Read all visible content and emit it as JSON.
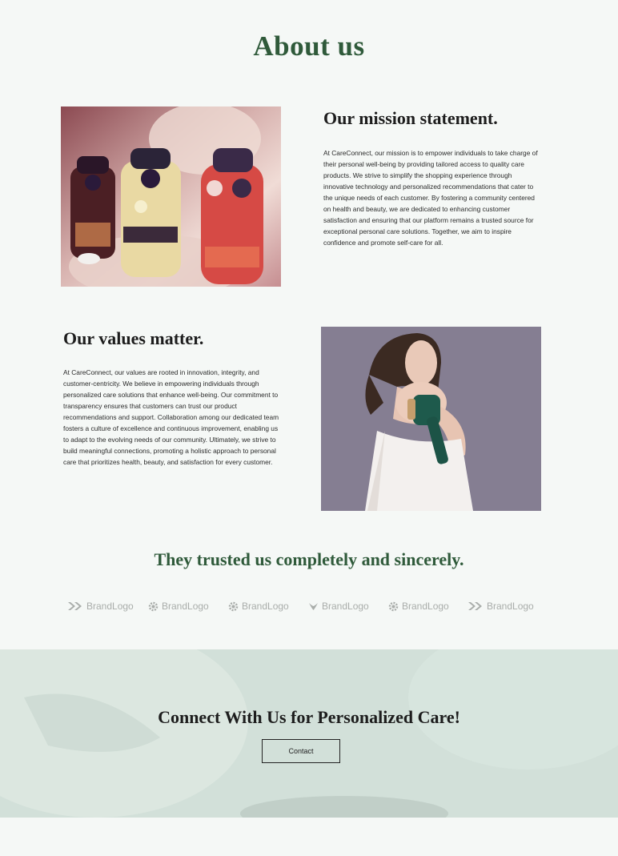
{
  "page": {
    "title": "About us"
  },
  "mission": {
    "heading": "Our mission statement.",
    "body": "At CareConnect, our mission is to empower individuals to take charge of their personal well-being by providing tailored access to quality care products. We strive to simplify the shopping experience through innovative technology and personalized recommendations that cater to the unique needs of each customer. By fostering a community centered on health and beauty, we are dedicated to enhancing customer satisfaction and ensuring that our platform remains a trusted source for exceptional personal care solutions. Together, we aim to inspire confidence and promote self-care for all."
  },
  "values": {
    "heading": "Our values matter.",
    "body": "At CareConnect, our values are rooted in innovation, integrity, and customer-centricity. We believe in empowering individuals through personalized care solutions that enhance well-being. Our commitment to transparency ensures that customers can trust our product recommendations and support. Collaboration among our dedicated team fosters a culture of excellence and continuous improvement, enabling us to adapt to the evolving needs of our community. Ultimately, we strive to build meaningful connections, promoting a holistic approach to personal care that prioritizes health, beauty, and satisfaction for every customer."
  },
  "trusted": {
    "heading": "They trusted us completely and sincerely.",
    "brands": [
      {
        "label": "BrandLogo",
        "icon": "double-chevron-icon"
      },
      {
        "label": "BrandLogo",
        "icon": "gear-icon"
      },
      {
        "label": "BrandLogo",
        "icon": "gear-icon"
      },
      {
        "label": "BrandLogo",
        "icon": "wing-icon"
      },
      {
        "label": "BrandLogo",
        "icon": "gear-icon"
      },
      {
        "label": "BrandLogo",
        "icon": "double-chevron-icon"
      }
    ]
  },
  "cta": {
    "heading": "Connect With Us for Personalized Care!",
    "button_label": "Contact"
  },
  "colors": {
    "background": "#f5f8f6",
    "accent_green": "#2f5a3a",
    "cta_background": "#d2e0d9",
    "brand_gray": "#a9adaa"
  }
}
